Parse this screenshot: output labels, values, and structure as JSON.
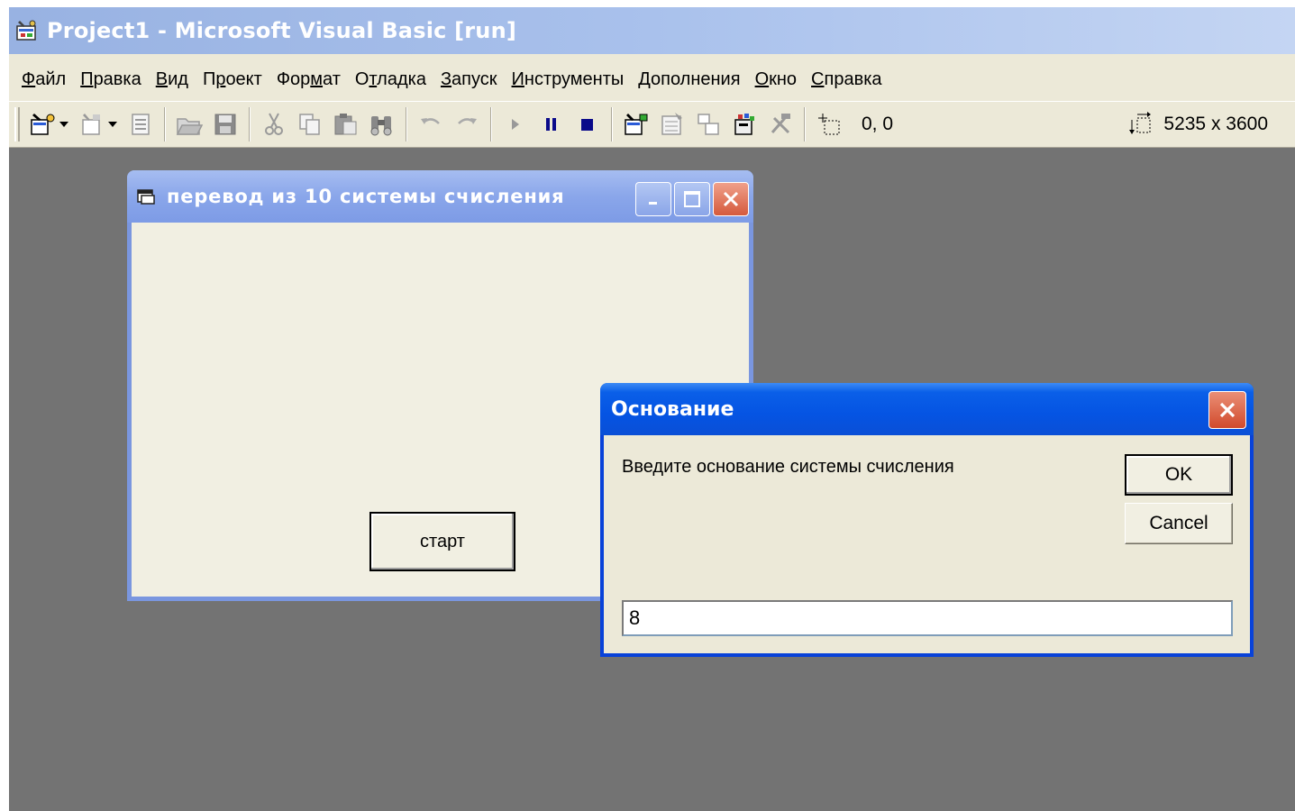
{
  "app": {
    "title": "Project1 - Microsoft Visual Basic [run]"
  },
  "menubar": {
    "items": [
      {
        "accel": "Ф",
        "rest": "айл"
      },
      {
        "accel": "П",
        "rest": "равка"
      },
      {
        "accel": "В",
        "rest": "ид"
      },
      {
        "pre": "П",
        "accel": "р",
        "rest": "оект"
      },
      {
        "pre": "Фор",
        "accel": "м",
        "rest": "ат"
      },
      {
        "pre": "О",
        "accel": "т",
        "rest": "ладка"
      },
      {
        "accel": "З",
        "rest": "апуск"
      },
      {
        "accel": "И",
        "rest": "нструменты"
      },
      {
        "pre": "",
        "accel": "Д",
        "rest": "ополнения"
      },
      {
        "accel": "О",
        "rest": "кно"
      },
      {
        "accel": "С",
        "rest": "правка"
      }
    ]
  },
  "toolbar": {
    "position_readout": "0, 0",
    "size_readout": "5235 x 3600"
  },
  "form": {
    "title": "перевод из 10 системы счисления",
    "start_button": "старт"
  },
  "dialog": {
    "title": "Основание",
    "prompt": "Введите основание системы счисления",
    "ok": "OK",
    "cancel": "Cancel",
    "input_value": "8"
  },
  "colors": {
    "workspace": "#737373",
    "dialog_title": "#0554e3",
    "form_title": "#8aa6ea",
    "close_red": "#d55a3c"
  }
}
